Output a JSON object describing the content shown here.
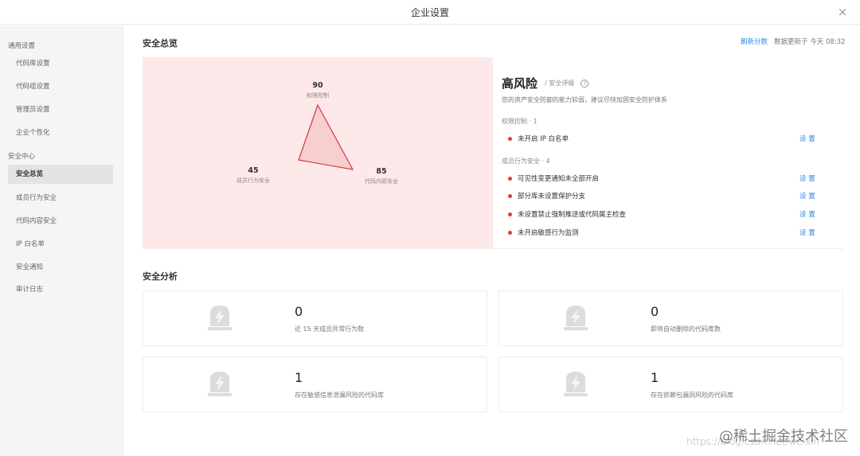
{
  "window": {
    "title": "企业设置",
    "close_glyph": "×"
  },
  "sidebar": {
    "groups": [
      {
        "label": "通用设置"
      },
      {
        "label": "安全中心"
      }
    ],
    "items": [
      {
        "label": "代码库设置"
      },
      {
        "label": "代码组设置"
      },
      {
        "label": "管理员设置"
      },
      {
        "label": "企业个性化"
      },
      {
        "label": "安全总览"
      },
      {
        "label": "成员行为安全"
      },
      {
        "label": "代码内容安全"
      },
      {
        "label": "IP 白名单"
      },
      {
        "label": "安全通知"
      },
      {
        "label": "审计日志"
      }
    ]
  },
  "overview": {
    "title": "安全总览",
    "refresh_label": "刷新分数",
    "updated_text": "数据更新于 今天 08:32",
    "radar": {
      "top_value": "90",
      "top_name": "权限控制",
      "left_value": "45",
      "left_name": "成员行为安全",
      "right_value": "85",
      "right_name": "代码内容安全",
      "fill_color": "#f7cfd0",
      "stroke_color": "#d6393e"
    },
    "risk_level": "高风险",
    "risk_sub": "/ 安全评级",
    "help_glyph": "?",
    "risk_desc": "您的资产安全防御的能力较弱，建议尽快加固安全防护体系",
    "categories": [
      {
        "label": "权限控制 · 1"
      },
      {
        "label": "成员行为安全 · 4"
      }
    ],
    "issues": [
      {
        "text": "未开启 IP 白名单",
        "action": "设 置"
      },
      {
        "text": "可见性变更通知未全部开启",
        "action": "设 置"
      },
      {
        "text": "部分库未设置保护分支",
        "action": "设 置"
      },
      {
        "text": "未设置禁止强制推送或代码属主检查",
        "action": "设 置"
      },
      {
        "text": "未开启敏感行为监测",
        "action": "设 置"
      }
    ]
  },
  "analysis": {
    "title": "安全分析",
    "cards": [
      {
        "value": "0",
        "label": "近 15 天成员异常行为数"
      },
      {
        "value": "0",
        "label": "即将自动删除的代码库数"
      },
      {
        "value": "1",
        "label": "存在敏感信息泄漏风险的代码库"
      },
      {
        "value": "1",
        "label": "存在依赖包漏洞风险的代码库"
      }
    ]
  },
  "watermark": {
    "text": "@稀土掘金技术社区",
    "url_text": "https://blog.csdn.net/weixin"
  }
}
